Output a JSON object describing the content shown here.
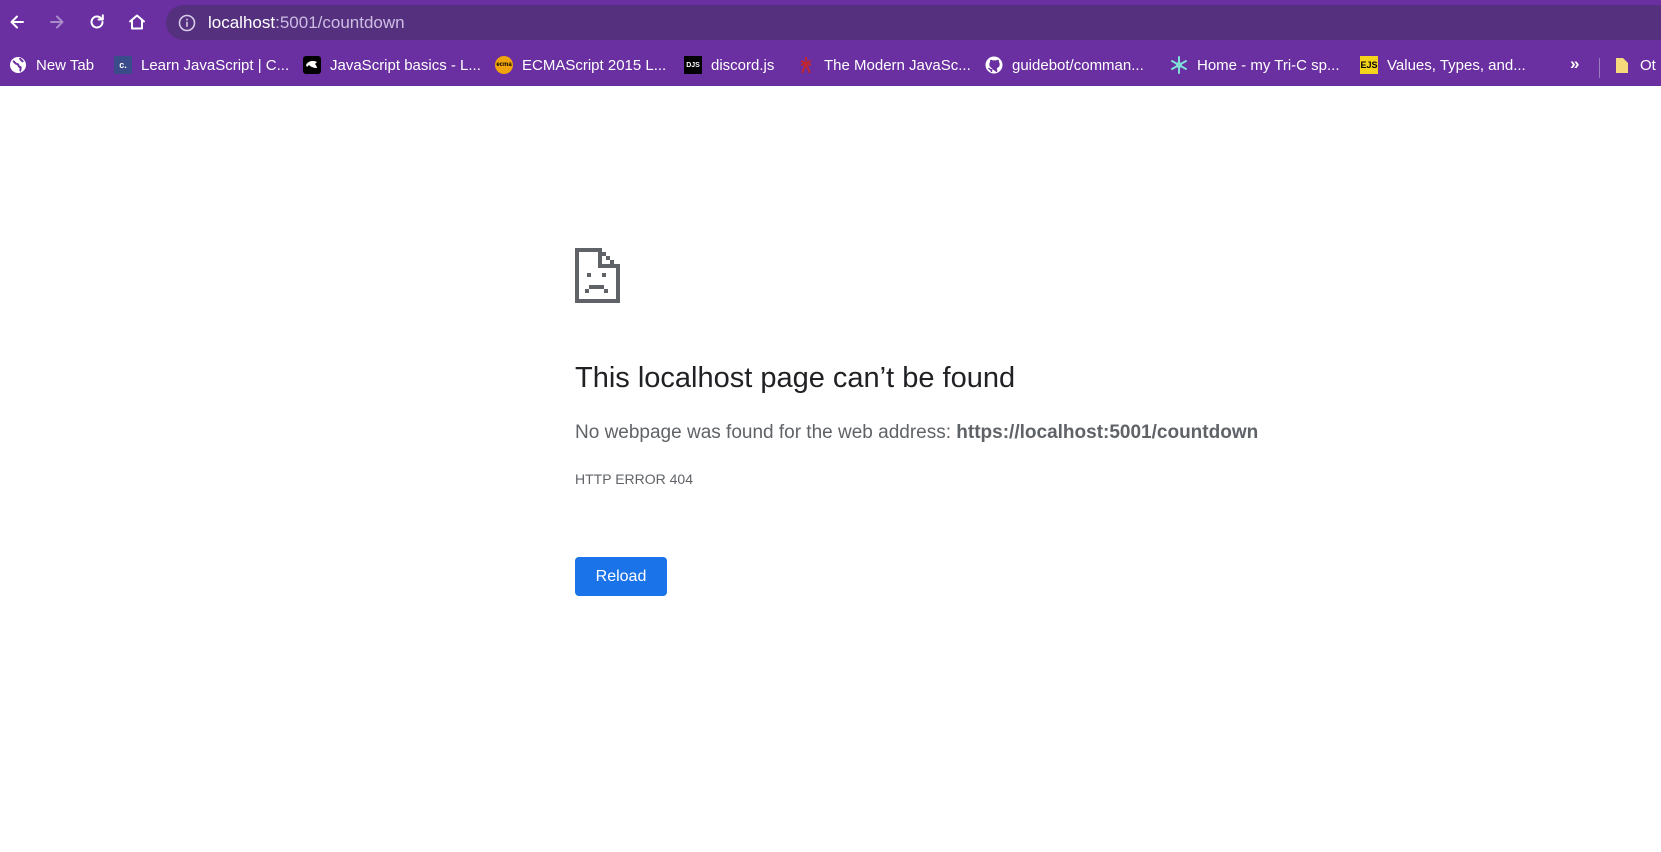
{
  "browser": {
    "url_host": "localhost",
    "url_path": ":5001/countdown",
    "bookmarks": [
      {
        "label": "New Tab",
        "icon": "globe-icon"
      },
      {
        "label": "Learn JavaScript | C...",
        "icon": "codecademy-icon",
        "badge": "c."
      },
      {
        "label": "JavaScript basics - L...",
        "icon": "mdn-icon"
      },
      {
        "label": "ECMAScript 2015 L...",
        "icon": "ecma-icon",
        "badge": "ecma"
      },
      {
        "label": "discord.js",
        "icon": "discordjs-icon",
        "badge": "DJS"
      },
      {
        "label": "The Modern JavaSc...",
        "icon": "javascript-info-icon"
      },
      {
        "label": "guidebot/comman...",
        "icon": "github-icon"
      },
      {
        "label": "Home - my Tri-C sp...",
        "icon": "snowflake-icon"
      },
      {
        "label": "Values, Types, and...",
        "icon": "ejs-icon",
        "badge": "EJS"
      }
    ],
    "more_bookmarks": "»",
    "other_bookmarks": "Ot"
  },
  "error": {
    "title": "This localhost page can’t be found",
    "description_prefix": "No webpage was found for the web address: ",
    "description_url": "https://localhost:5001/countdown",
    "code": "HTTP ERROR 404",
    "reload_label": "Reload"
  },
  "colors": {
    "chrome_bg": "#6a2fa0",
    "omnibox_bg": "#55307f",
    "button_blue": "#1a73e8"
  }
}
